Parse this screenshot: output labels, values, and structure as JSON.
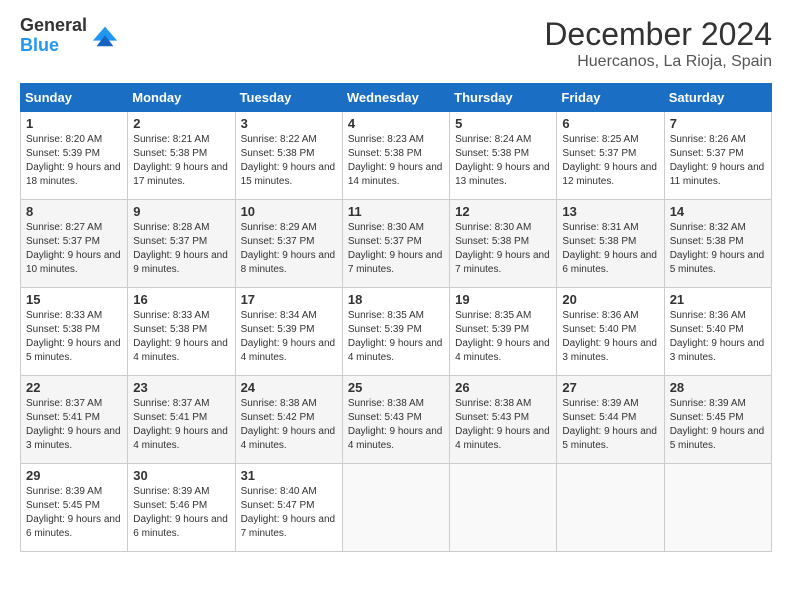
{
  "logo": {
    "line1": "General",
    "line2": "Blue"
  },
  "title": "December 2024",
  "location": "Huercanos, La Rioja, Spain",
  "days_of_week": [
    "Sunday",
    "Monday",
    "Tuesday",
    "Wednesday",
    "Thursday",
    "Friday",
    "Saturday"
  ],
  "weeks": [
    [
      {
        "day": "1",
        "sunrise": "8:20 AM",
        "sunset": "5:39 PM",
        "daylight": "9 hours and 18 minutes."
      },
      {
        "day": "2",
        "sunrise": "8:21 AM",
        "sunset": "5:38 PM",
        "daylight": "9 hours and 17 minutes."
      },
      {
        "day": "3",
        "sunrise": "8:22 AM",
        "sunset": "5:38 PM",
        "daylight": "9 hours and 15 minutes."
      },
      {
        "day": "4",
        "sunrise": "8:23 AM",
        "sunset": "5:38 PM",
        "daylight": "9 hours and 14 minutes."
      },
      {
        "day": "5",
        "sunrise": "8:24 AM",
        "sunset": "5:38 PM",
        "daylight": "9 hours and 13 minutes."
      },
      {
        "day": "6",
        "sunrise": "8:25 AM",
        "sunset": "5:37 PM",
        "daylight": "9 hours and 12 minutes."
      },
      {
        "day": "7",
        "sunrise": "8:26 AM",
        "sunset": "5:37 PM",
        "daylight": "9 hours and 11 minutes."
      }
    ],
    [
      {
        "day": "8",
        "sunrise": "8:27 AM",
        "sunset": "5:37 PM",
        "daylight": "9 hours and 10 minutes."
      },
      {
        "day": "9",
        "sunrise": "8:28 AM",
        "sunset": "5:37 PM",
        "daylight": "9 hours and 9 minutes."
      },
      {
        "day": "10",
        "sunrise": "8:29 AM",
        "sunset": "5:37 PM",
        "daylight": "9 hours and 8 minutes."
      },
      {
        "day": "11",
        "sunrise": "8:30 AM",
        "sunset": "5:37 PM",
        "daylight": "9 hours and 7 minutes."
      },
      {
        "day": "12",
        "sunrise": "8:30 AM",
        "sunset": "5:38 PM",
        "daylight": "9 hours and 7 minutes."
      },
      {
        "day": "13",
        "sunrise": "8:31 AM",
        "sunset": "5:38 PM",
        "daylight": "9 hours and 6 minutes."
      },
      {
        "day": "14",
        "sunrise": "8:32 AM",
        "sunset": "5:38 PM",
        "daylight": "9 hours and 5 minutes."
      }
    ],
    [
      {
        "day": "15",
        "sunrise": "8:33 AM",
        "sunset": "5:38 PM",
        "daylight": "9 hours and 5 minutes."
      },
      {
        "day": "16",
        "sunrise": "8:33 AM",
        "sunset": "5:38 PM",
        "daylight": "9 hours and 4 minutes."
      },
      {
        "day": "17",
        "sunrise": "8:34 AM",
        "sunset": "5:39 PM",
        "daylight": "9 hours and 4 minutes."
      },
      {
        "day": "18",
        "sunrise": "8:35 AM",
        "sunset": "5:39 PM",
        "daylight": "9 hours and 4 minutes."
      },
      {
        "day": "19",
        "sunrise": "8:35 AM",
        "sunset": "5:39 PM",
        "daylight": "9 hours and 4 minutes."
      },
      {
        "day": "20",
        "sunrise": "8:36 AM",
        "sunset": "5:40 PM",
        "daylight": "9 hours and 3 minutes."
      },
      {
        "day": "21",
        "sunrise": "8:36 AM",
        "sunset": "5:40 PM",
        "daylight": "9 hours and 3 minutes."
      }
    ],
    [
      {
        "day": "22",
        "sunrise": "8:37 AM",
        "sunset": "5:41 PM",
        "daylight": "9 hours and 3 minutes."
      },
      {
        "day": "23",
        "sunrise": "8:37 AM",
        "sunset": "5:41 PM",
        "daylight": "9 hours and 4 minutes."
      },
      {
        "day": "24",
        "sunrise": "8:38 AM",
        "sunset": "5:42 PM",
        "daylight": "9 hours and 4 minutes."
      },
      {
        "day": "25",
        "sunrise": "8:38 AM",
        "sunset": "5:43 PM",
        "daylight": "9 hours and 4 minutes."
      },
      {
        "day": "26",
        "sunrise": "8:38 AM",
        "sunset": "5:43 PM",
        "daylight": "9 hours and 4 minutes."
      },
      {
        "day": "27",
        "sunrise": "8:39 AM",
        "sunset": "5:44 PM",
        "daylight": "9 hours and 5 minutes."
      },
      {
        "day": "28",
        "sunrise": "8:39 AM",
        "sunset": "5:45 PM",
        "daylight": "9 hours and 5 minutes."
      }
    ],
    [
      {
        "day": "29",
        "sunrise": "8:39 AM",
        "sunset": "5:45 PM",
        "daylight": "9 hours and 6 minutes."
      },
      {
        "day": "30",
        "sunrise": "8:39 AM",
        "sunset": "5:46 PM",
        "daylight": "9 hours and 6 minutes."
      },
      {
        "day": "31",
        "sunrise": "8:40 AM",
        "sunset": "5:47 PM",
        "daylight": "9 hours and 7 minutes."
      },
      null,
      null,
      null,
      null
    ]
  ]
}
